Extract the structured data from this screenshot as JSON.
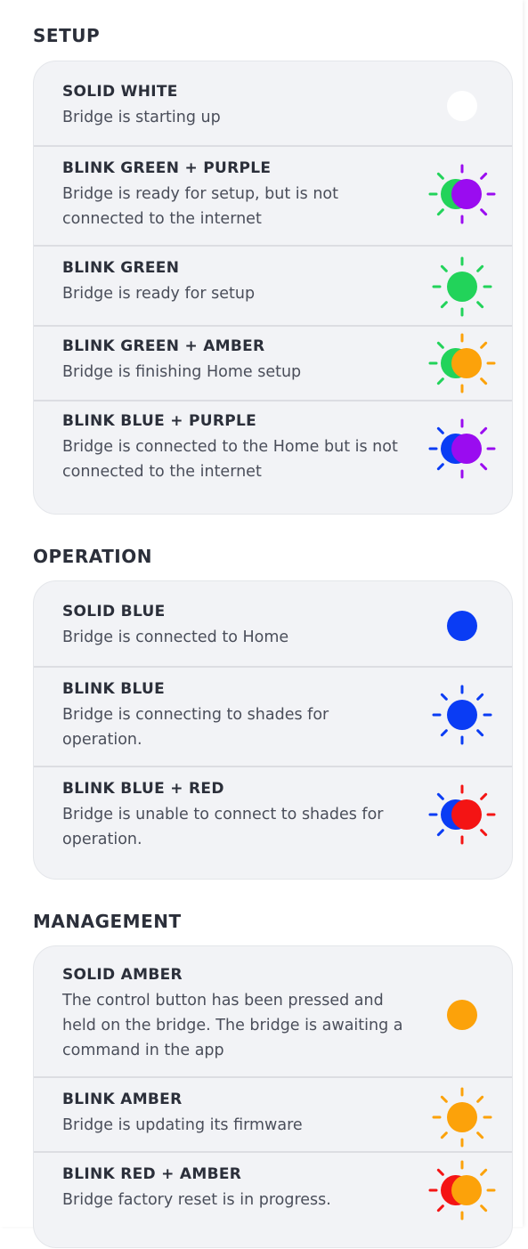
{
  "colors": {
    "white": "#ffffff",
    "green": "#22d35a",
    "purple": "#9a0cf0",
    "amber": "#fca20a",
    "blue": "#0a3cf4",
    "red": "#f41414"
  },
  "sections": [
    {
      "title": "SETUP",
      "items": [
        {
          "title": "SOLID WHITE",
          "desc": "Bridge is starting up",
          "indicator": {
            "type": "solid",
            "colors": [
              "#ffffff"
            ]
          }
        },
        {
          "title": "BLINK GREEN + PURPLE",
          "desc": "Bridge is ready for setup, but is not connected to the internet",
          "indicator": {
            "type": "blink",
            "colors": [
              "#22d35a",
              "#9a0cf0"
            ]
          }
        },
        {
          "title": "BLINK GREEN",
          "desc": "Bridge is ready for setup",
          "indicator": {
            "type": "blink",
            "colors": [
              "#22d35a"
            ]
          }
        },
        {
          "title": "BLINK GREEN + AMBER",
          "desc": "Bridge is finishing Home setup",
          "indicator": {
            "type": "blink",
            "colors": [
              "#22d35a",
              "#fca20a"
            ]
          }
        },
        {
          "title": "BLINK BLUE + PURPLE",
          "desc": "Bridge is connected to the Home but is not connected to the internet",
          "indicator": {
            "type": "blink",
            "colors": [
              "#0a3cf4",
              "#9a0cf0"
            ]
          }
        }
      ]
    },
    {
      "title": "OPERATION",
      "items": [
        {
          "title": "SOLID BLUE",
          "desc": "Bridge is connected to Home",
          "indicator": {
            "type": "solid",
            "colors": [
              "#0a3cf4"
            ]
          }
        },
        {
          "title": "BLINK BLUE",
          "desc": "Bridge is connecting to shades for operation.",
          "indicator": {
            "type": "blink",
            "colors": [
              "#0a3cf4"
            ]
          }
        },
        {
          "title": "BLINK BLUE + RED",
          "desc": "Bridge is unable to connect to shades for operation.",
          "indicator": {
            "type": "blink",
            "colors": [
              "#0a3cf4",
              "#f41414"
            ]
          }
        }
      ]
    },
    {
      "title": "MANAGEMENT",
      "items": [
        {
          "title": "SOLID AMBER",
          "desc": "The control button has been pressed and held on the bridge. The bridge is awaiting a command in the app",
          "indicator": {
            "type": "solid",
            "colors": [
              "#fca20a"
            ]
          }
        },
        {
          "title": "BLINK AMBER",
          "desc": "Bridge is updating its firmware",
          "indicator": {
            "type": "blink",
            "colors": [
              "#fca20a"
            ]
          }
        },
        {
          "title": "BLINK RED + AMBER",
          "desc": "Bridge factory reset is in progress.",
          "indicator": {
            "type": "blink",
            "colors": [
              "#f41414",
              "#fca20a"
            ]
          }
        }
      ]
    }
  ]
}
